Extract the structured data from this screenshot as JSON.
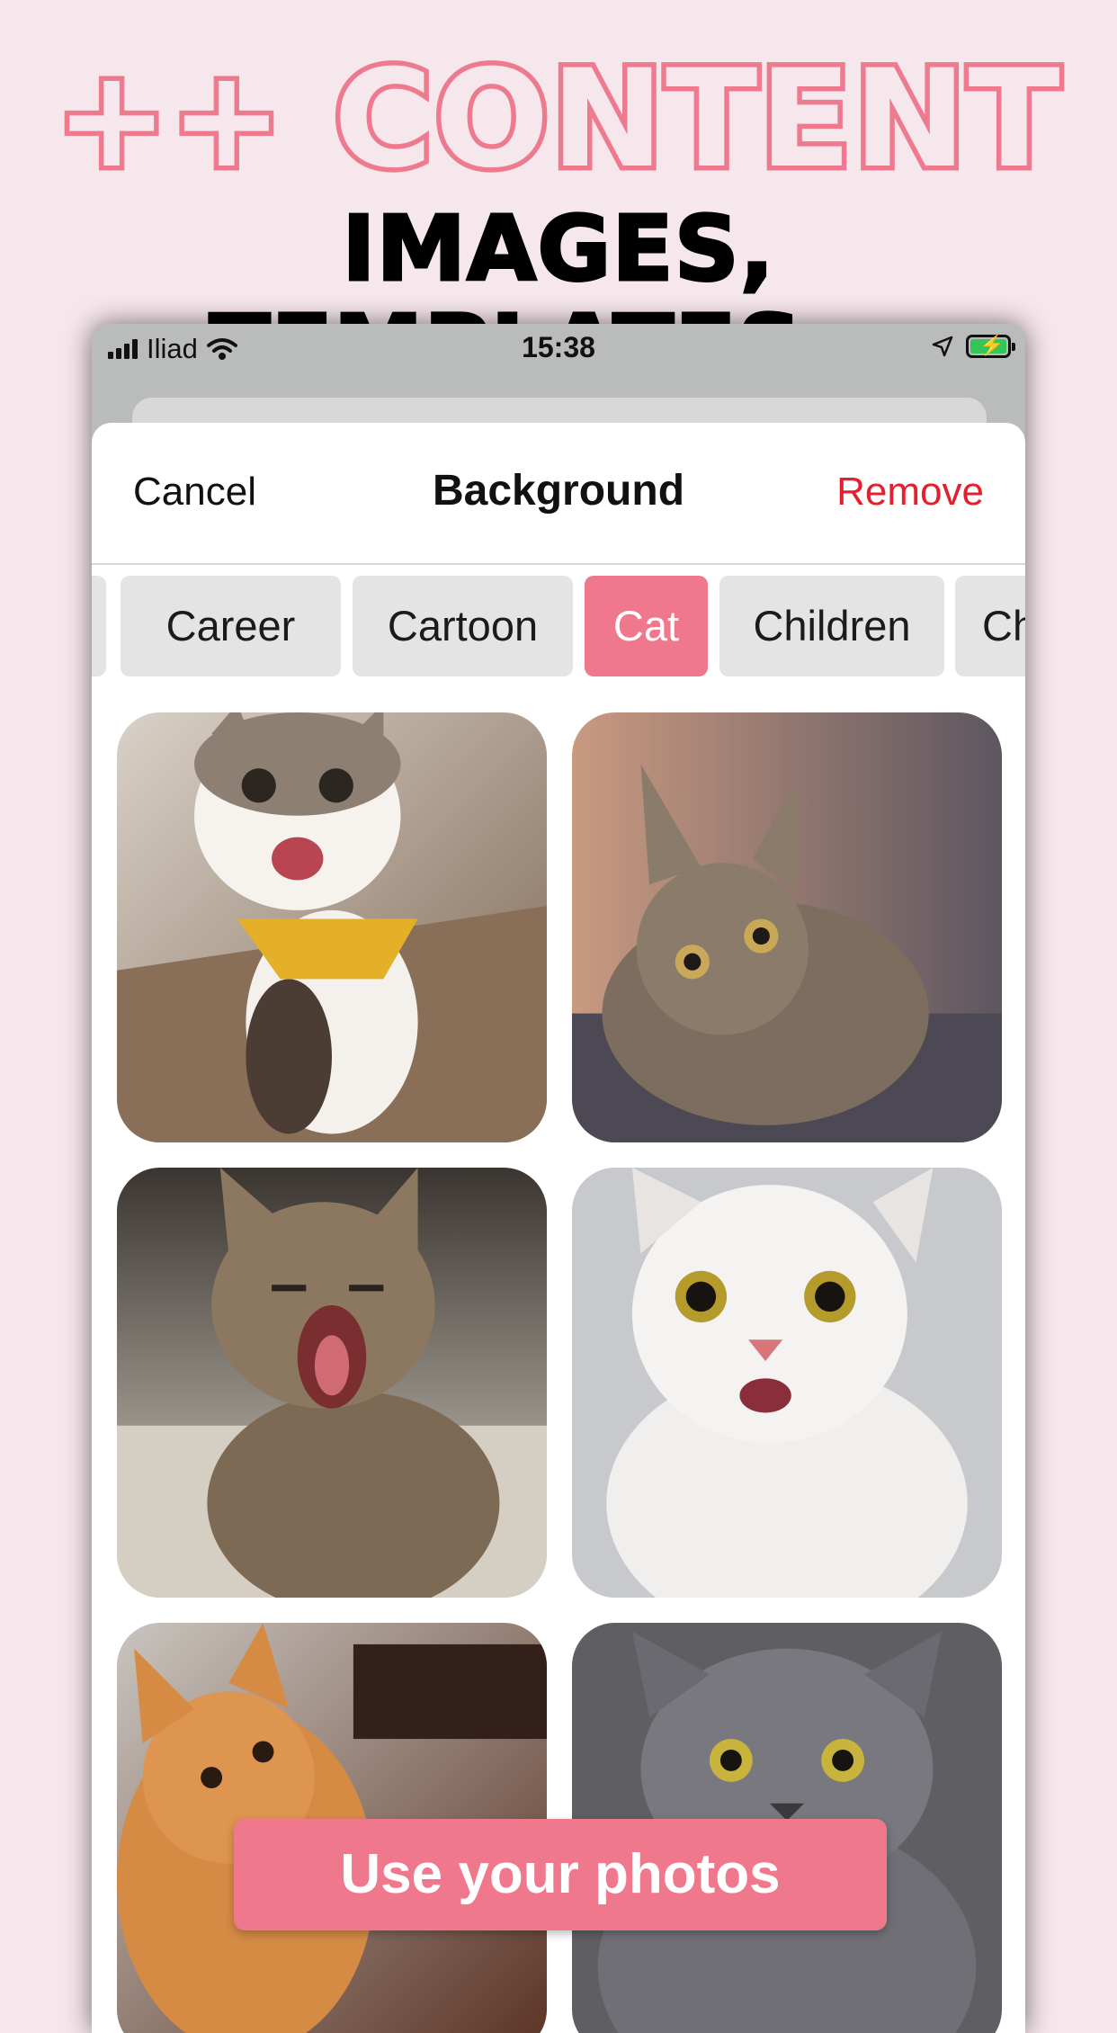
{
  "promo": {
    "headline_1": "++ CONTENT",
    "headline_2": "IMAGES, TEMPLATES..."
  },
  "status_bar": {
    "carrier": "Iliad",
    "time": "15:38"
  },
  "nav": {
    "cancel_label": "Cancel",
    "title": "Background",
    "remove_label": "Remove"
  },
  "categories": {
    "items": [
      {
        "label": ""
      },
      {
        "label": "Career"
      },
      {
        "label": "Cartoon"
      },
      {
        "label": "Cat"
      },
      {
        "label": "Children"
      },
      {
        "label": "Chr"
      }
    ],
    "selected": "Cat"
  },
  "photos": [
    {
      "subject": "cat-photo-1"
    },
    {
      "subject": "cat-photo-2"
    },
    {
      "subject": "cat-photo-3"
    },
    {
      "subject": "cat-photo-4"
    },
    {
      "subject": "cat-photo-5"
    },
    {
      "subject": "cat-photo-6"
    }
  ],
  "cta": {
    "label": "Use your photos"
  },
  "colors": {
    "accent": "#ef788c",
    "remove": "#e3202e",
    "page_bg": "#f6e7ec",
    "chip_bg": "#e4e4e4"
  }
}
